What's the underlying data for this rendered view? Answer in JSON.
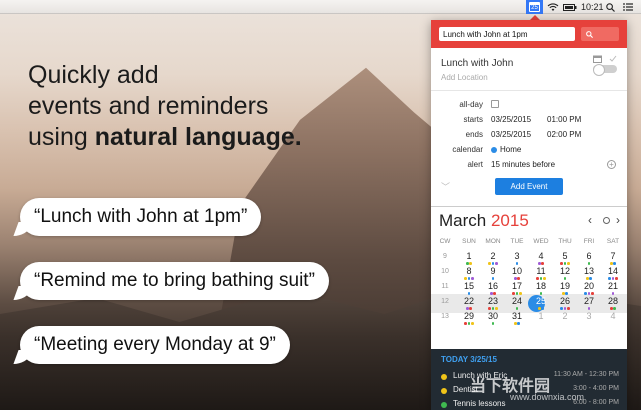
{
  "menubar": {
    "calendar_day": "25",
    "clock": "10:21"
  },
  "headline": {
    "line1": "Quickly add",
    "line2": "events and reminders",
    "line3_prefix": "using ",
    "line3_bold": "natural language."
  },
  "bubbles": [
    "“Lunch with John at 1pm”",
    "“Remind me to bring bathing suit”",
    "“Meeting every Monday at 9”"
  ],
  "panel": {
    "input_value": "Lunch with John at 1pm",
    "event_title": "Lunch with John",
    "location_placeholder": "Add Location",
    "form": {
      "allday_label": "all-day",
      "starts_label": "starts",
      "starts_date": "03/25/2015",
      "starts_time": "01:00 PM",
      "ends_label": "ends",
      "ends_date": "03/25/2015",
      "ends_time": "02:00 PM",
      "calendar_label": "calendar",
      "calendar_value": "Home",
      "alert_label": "alert",
      "alert_value": "15 minutes before"
    },
    "add_button": "Add Event",
    "calendar": {
      "month": "March",
      "year": "2015",
      "dow": [
        "CW",
        "SUN",
        "MON",
        "TUE",
        "WED",
        "THU",
        "FRI",
        "SAT"
      ],
      "weeks": [
        [
          "9",
          "1",
          "2",
          "3",
          "4",
          "5",
          "6",
          "7"
        ],
        [
          "10",
          "8",
          "9",
          "10",
          "11",
          "12",
          "13",
          "14"
        ],
        [
          "11",
          "15",
          "16",
          "17",
          "18",
          "19",
          "20",
          "21"
        ],
        [
          "12",
          "22",
          "23",
          "24",
          "25",
          "26",
          "27",
          "28"
        ],
        [
          "13",
          "29",
          "30",
          "31",
          "1",
          "2",
          "3",
          "4"
        ]
      ],
      "selected": "25"
    },
    "agenda": {
      "header": "TODAY 3/25/15",
      "items": [
        {
          "title": "Lunch with Eric",
          "time": "11:30 AM - 12:30 PM",
          "color": "#f0c419"
        },
        {
          "title": "Dentist",
          "time": "3:00 - 4:00 PM",
          "color": "#f0c419"
        },
        {
          "title": "Tennis lessons",
          "time": "6:00 - 8:00 PM",
          "color": "#3fb950"
        }
      ]
    }
  },
  "watermark": {
    "cn": "当下软件园",
    "url": "www.downxia.com"
  }
}
